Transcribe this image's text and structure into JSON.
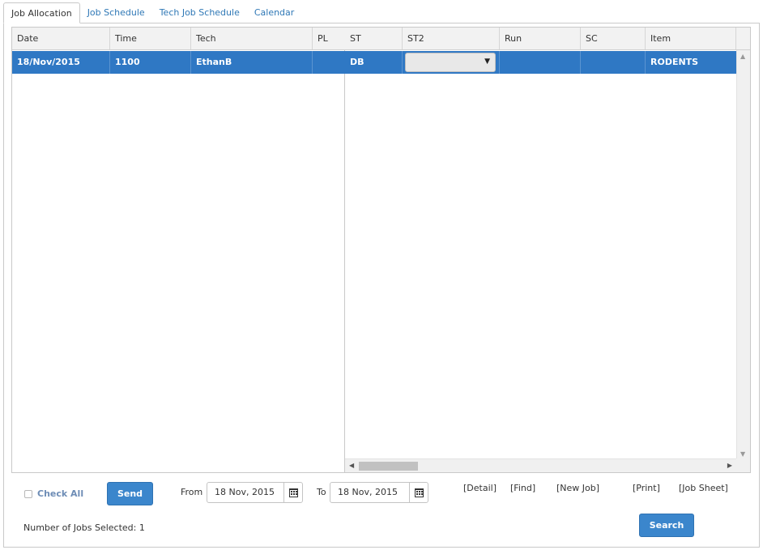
{
  "tabs": [
    {
      "label": "Job Allocation",
      "active": true
    },
    {
      "label": "Job Schedule",
      "active": false
    },
    {
      "label": "Tech Job Schedule",
      "active": false
    },
    {
      "label": "Calendar",
      "active": false
    }
  ],
  "grid": {
    "frozen_headers": [
      "Date",
      "Time",
      "Tech",
      "PL"
    ],
    "scroll_headers": [
      "ST",
      "ST2",
      "Run",
      "SC",
      "Item"
    ],
    "row": {
      "date": "18/Nov/2015",
      "time": "1100",
      "tech": "EthanB",
      "pl": "",
      "st": "DB",
      "st2": "",
      "run": "",
      "sc": "",
      "item": "RODENTS"
    },
    "selected_row_color": "#2f78c4"
  },
  "controls": {
    "check_all_label": "Check All",
    "send_label": "Send",
    "from_label": "From",
    "from_value": "18 Nov, 2015",
    "to_label": "To",
    "to_value": "18 Nov, 2015",
    "links": [
      "[Detail]",
      "[Find]",
      "[New Job]",
      "[Print]",
      "[Job Sheet]"
    ],
    "search_label": "Search",
    "jobs_selected": "Number of Jobs Selected: 1"
  },
  "icons": {
    "calendar": "calendar-icon",
    "dropdown": "caret-down-icon"
  }
}
